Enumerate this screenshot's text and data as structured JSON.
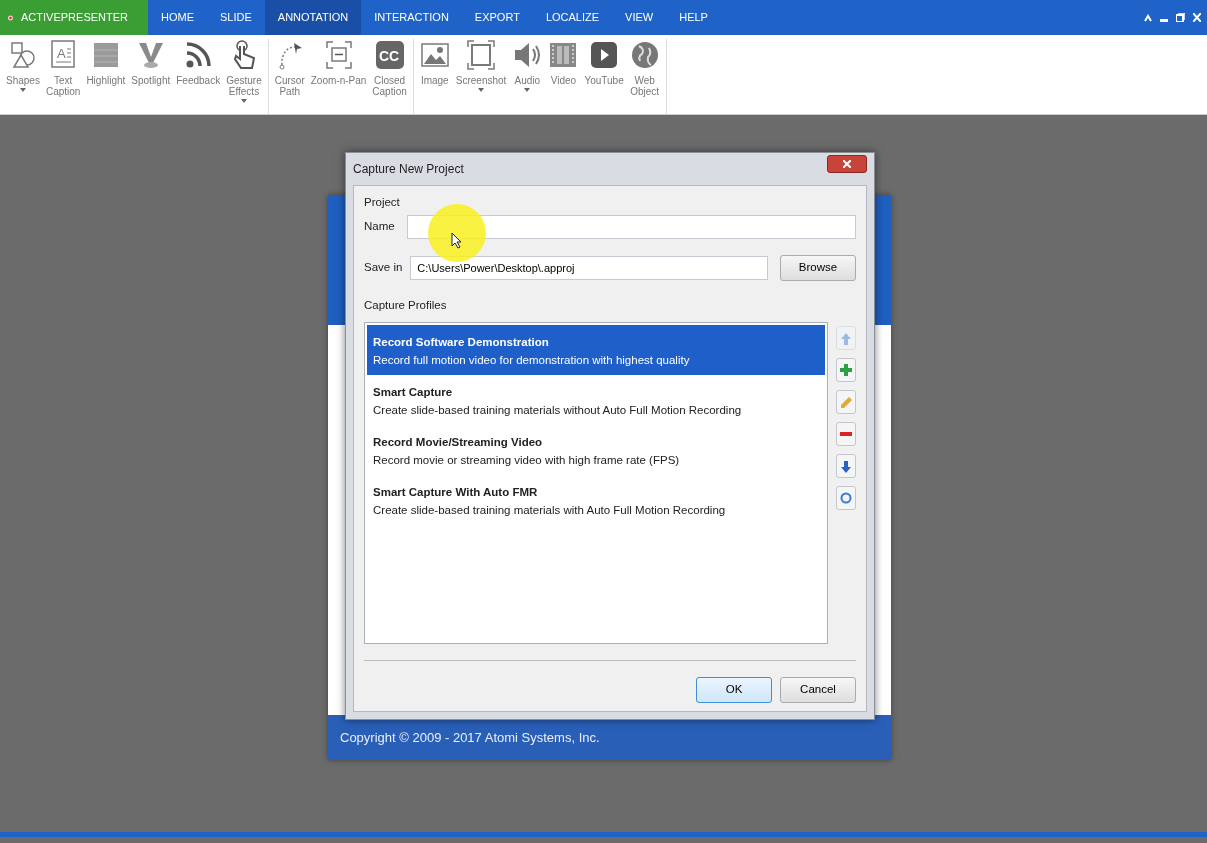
{
  "app_tab": {
    "label": "ACTIVEPRESENTER"
  },
  "tabs": [
    {
      "label": "HOME",
      "selected": false
    },
    {
      "label": "SLIDE",
      "selected": false
    },
    {
      "label": "ANNOTATION",
      "selected": true
    },
    {
      "label": "INTERACTION",
      "selected": false
    },
    {
      "label": "EXPORT",
      "selected": false
    },
    {
      "label": "LOCALIZE",
      "selected": false
    },
    {
      "label": "VIEW",
      "selected": false
    },
    {
      "label": "HELP",
      "selected": false
    }
  ],
  "ribbon_groups": [
    {
      "tools": [
        {
          "label": "Shapes",
          "dropdown": true
        },
        {
          "label": "Text\nCaption",
          "dropdown": false,
          "icon_text": "A"
        },
        {
          "label": "Highlight",
          "dropdown": false
        },
        {
          "label": "Spotlight",
          "dropdown": false
        },
        {
          "label": "Feedback",
          "dropdown": false
        },
        {
          "label": "Gesture\nEffects",
          "dropdown": true
        }
      ]
    },
    {
      "tools": [
        {
          "label": "Cursor\nPath",
          "dropdown": false
        },
        {
          "label": "Zoom-n-Pan",
          "dropdown": false
        },
        {
          "label": "Closed\nCaption",
          "dropdown": false,
          "icon_text": "CC"
        }
      ]
    },
    {
      "tools": [
        {
          "label": "Image",
          "dropdown": false
        },
        {
          "label": "Screenshot",
          "dropdown": true
        },
        {
          "label": "Audio",
          "dropdown": true
        },
        {
          "label": "Video",
          "dropdown": false
        },
        {
          "label": "YouTube",
          "dropdown": false
        },
        {
          "label": "Web\nObject",
          "dropdown": false
        }
      ]
    }
  ],
  "start_window": {
    "copyright": "Copyright © 2009 - 2017 Atomi Systems, Inc."
  },
  "dialog": {
    "title": "Capture New Project",
    "project_label": "Project",
    "name_label": "Name",
    "save_label": "Save in",
    "save_value": "C:\\Users\\Power\\Desktop\\.approj",
    "browse": "Browse",
    "profiles_label": "Capture Profiles",
    "profiles": [
      {
        "title": "Record Software Demonstration",
        "description": "Record full motion video for demonstration with highest quality",
        "selected": true
      },
      {
        "title": "Smart Capture",
        "description": "Create slide-based training materials without Auto Full Motion Recording",
        "selected": false
      },
      {
        "title": "Record Movie/Streaming Video",
        "description": "Record movie or streaming video with high frame rate (FPS)",
        "selected": false
      },
      {
        "title": "Smart Capture With Auto FMR",
        "description": "Create slide-based training materials with Auto Full Motion Recording",
        "selected": false
      }
    ],
    "side_buttons": [
      {
        "kind": "up",
        "disabled": true
      },
      {
        "kind": "add",
        "disabled": false
      },
      {
        "kind": "edit",
        "disabled": false
      },
      {
        "kind": "remove",
        "disabled": false
      },
      {
        "kind": "down",
        "disabled": false
      },
      {
        "kind": "reset",
        "disabled": false
      }
    ],
    "ok": "OK",
    "cancel": "Cancel"
  }
}
